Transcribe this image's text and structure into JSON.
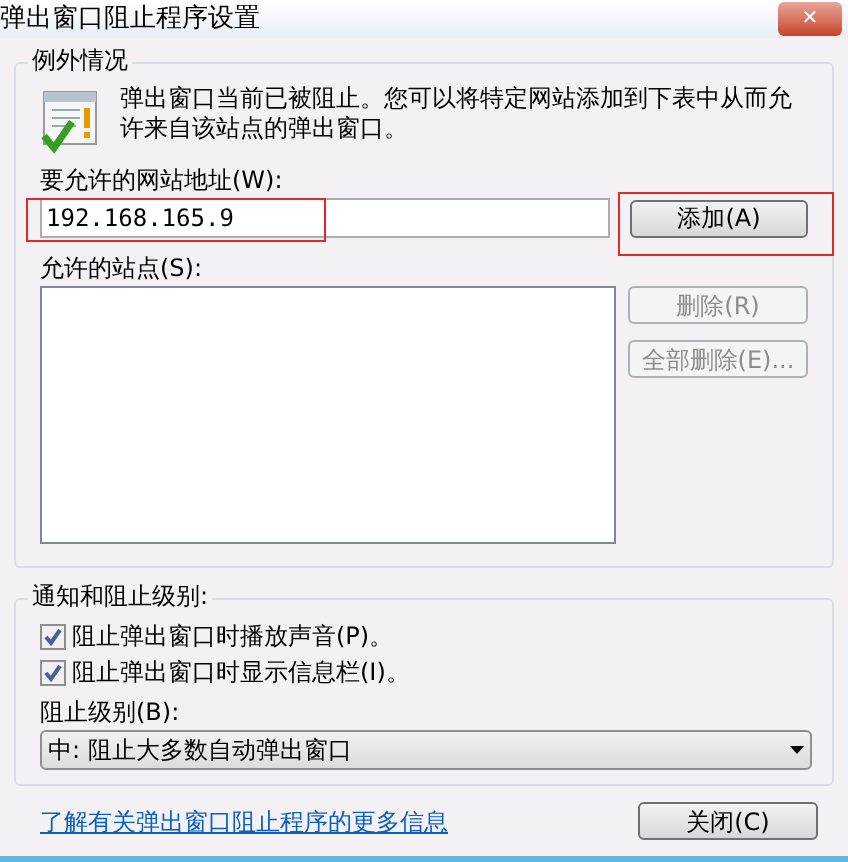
{
  "window": {
    "title": "弹出窗口阻止程序设置",
    "close_symbol": "✕"
  },
  "exceptions": {
    "title": "例外情况",
    "message": "弹出窗口当前已被阻止。您可以将特定网站添加到下表中从而允许来自该站点的弹出窗口。",
    "address_label": "要允许的网站地址(W):",
    "address_value": "192.168.165.9",
    "add_button": {
      "label": "添加(A)",
      "disabled": false
    },
    "sites_label": "允许的站点(S):",
    "buttons": [
      {
        "label": "删除(R)",
        "disabled": true
      },
      {
        "label": "全部删除(E)...",
        "disabled": true
      }
    ]
  },
  "notifications": {
    "title": "通知和阻止级别:",
    "options": [
      {
        "label": "阻止弹出窗口时播放声音(P)。",
        "checked": true
      },
      {
        "label": "阻止弹出窗口时显示信息栏(I)。",
        "checked": true
      }
    ],
    "level_label": "阻止级别(B):",
    "level_value": "中: 阻止大多数自动弹出窗口"
  },
  "footer": {
    "link": "了解有关弹出窗口阻止程序的更多信息",
    "close_button": "关闭(C)"
  }
}
